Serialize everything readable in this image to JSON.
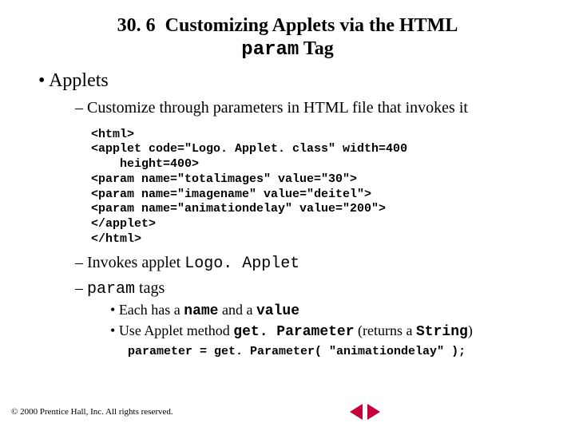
{
  "title": {
    "number": "30. 6",
    "text_a": "Customizing Applets via the HTML",
    "code": "param",
    "text_b": "Tag"
  },
  "bullets": {
    "applets": "Applets",
    "customize": "Customize through parameters in HTML file that invokes it",
    "code": "<html>\n<applet code=\"Logo. Applet. class\" width=400\n    height=400>\n<param name=\"totalimages\" value=\"30\">\n<param name=\"imagename\" value=\"deitel\">\n<param name=\"animationdelay\" value=\"200\">\n</applet>\n</html>",
    "invokes_a": "Invokes applet ",
    "invokes_b": "Logo. Applet",
    "paramtags_a": "param",
    "paramtags_b": " tags",
    "each_a": "Each has a ",
    "each_b": "name",
    "each_c": " and a ",
    "each_d": "value",
    "use_a": "Use Applet method ",
    "use_b": "get. Parameter",
    "use_c": " (returns a ",
    "use_d": "String",
    "use_e": ")",
    "codeline": "parameter = get. Parameter( \"animationdelay\" );"
  },
  "footer": {
    "copyright": "© 2000 Prentice Hall, Inc. All rights reserved."
  }
}
